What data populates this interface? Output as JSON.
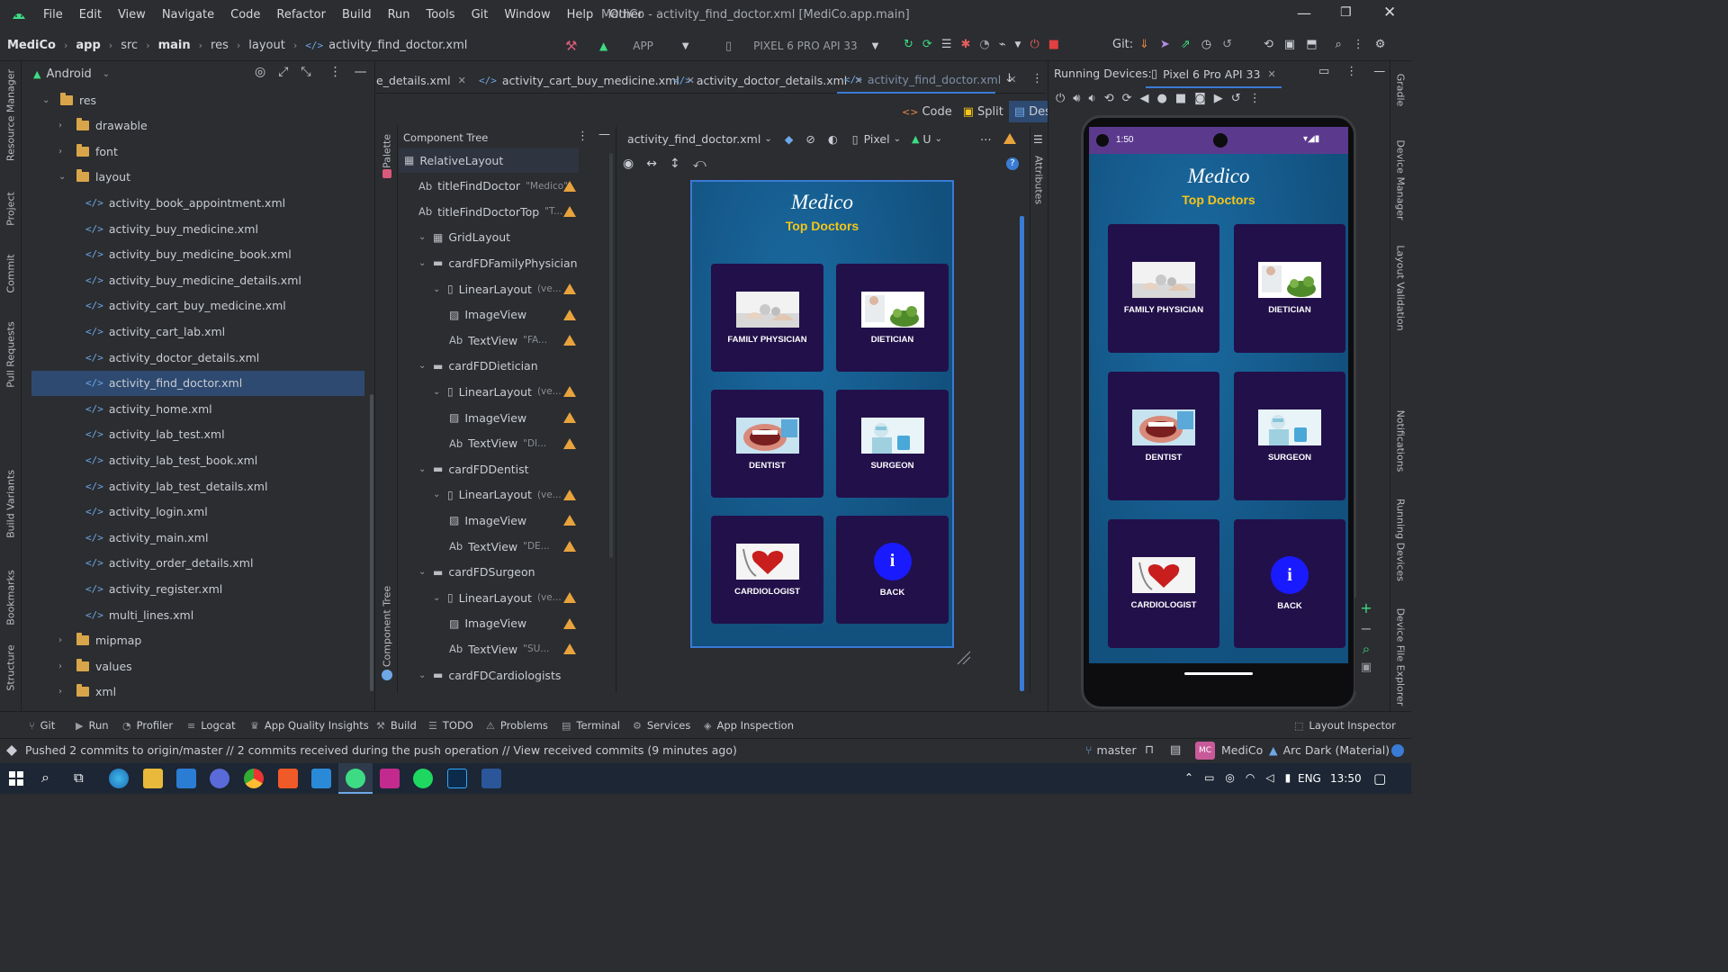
{
  "menu": {
    "items": [
      "File",
      "Edit",
      "View",
      "Navigate",
      "Code",
      "Refactor",
      "Build",
      "Run",
      "Tools",
      "Git",
      "Window",
      "Help",
      "Other"
    ],
    "window_title": "MediCo - activity_find_doctor.xml [MediCo.app.main]"
  },
  "breadcrumb": {
    "items": [
      "MediCo",
      "app",
      "src",
      "main",
      "res",
      "layout",
      "activity_find_doctor.xml"
    ]
  },
  "toolbar": {
    "run_config": "APP",
    "device": "PIXEL 6 PRO API 33",
    "git_label": "Git:"
  },
  "project": {
    "view_label": "Android",
    "tree": [
      {
        "label": "res",
        "level": 0,
        "type": "folder",
        "expanded": true
      },
      {
        "label": "drawable",
        "level": 1,
        "type": "folder",
        "expanded": false
      },
      {
        "label": "font",
        "level": 1,
        "type": "folder",
        "expanded": false
      },
      {
        "label": "layout",
        "level": 1,
        "type": "folder",
        "expanded": true
      },
      {
        "label": "activity_book_appointment.xml",
        "level": 2,
        "type": "xml"
      },
      {
        "label": "activity_buy_medicine.xml",
        "level": 2,
        "type": "xml"
      },
      {
        "label": "activity_buy_medicine_book.xml",
        "level": 2,
        "type": "xml"
      },
      {
        "label": "activity_buy_medicine_details.xml",
        "level": 2,
        "type": "xml"
      },
      {
        "label": "activity_cart_buy_medicine.xml",
        "level": 2,
        "type": "xml"
      },
      {
        "label": "activity_cart_lab.xml",
        "level": 2,
        "type": "xml"
      },
      {
        "label": "activity_doctor_details.xml",
        "level": 2,
        "type": "xml"
      },
      {
        "label": "activity_find_doctor.xml",
        "level": 2,
        "type": "xml",
        "selected": true
      },
      {
        "label": "activity_home.xml",
        "level": 2,
        "type": "xml"
      },
      {
        "label": "activity_lab_test.xml",
        "level": 2,
        "type": "xml"
      },
      {
        "label": "activity_lab_test_book.xml",
        "level": 2,
        "type": "xml"
      },
      {
        "label": "activity_lab_test_details.xml",
        "level": 2,
        "type": "xml"
      },
      {
        "label": "activity_login.xml",
        "level": 2,
        "type": "xml"
      },
      {
        "label": "activity_main.xml",
        "level": 2,
        "type": "xml"
      },
      {
        "label": "activity_order_details.xml",
        "level": 2,
        "type": "xml"
      },
      {
        "label": "activity_register.xml",
        "level": 2,
        "type": "xml"
      },
      {
        "label": "multi_lines.xml",
        "level": 2,
        "type": "xml"
      },
      {
        "label": "mipmap",
        "level": 1,
        "type": "folder",
        "expanded": false
      },
      {
        "label": "values",
        "level": 1,
        "type": "folder",
        "expanded": false
      },
      {
        "label": "xml",
        "level": 1,
        "type": "folder",
        "expanded": false
      }
    ]
  },
  "left_stripe": [
    "Resource Manager",
    "Project",
    "Commit",
    "Pull Requests",
    "Build Variants",
    "Bookmarks",
    "Structure"
  ],
  "right_stripe": [
    "Gradle",
    "Device Manager",
    "Layout Validation",
    "Notifications",
    "Running Devices",
    "Device File Explorer"
  ],
  "editor": {
    "tabs": [
      {
        "label": "e_details.xml",
        "active": false
      },
      {
        "label": "activity_cart_buy_medicine.xml",
        "active": false
      },
      {
        "label": "activity_doctor_details.xml",
        "active": false
      },
      {
        "label": "activity_find_doctor.xml",
        "active": true
      }
    ],
    "view_modes": [
      "Code",
      "Split",
      "Design"
    ],
    "file_selector": "activity_find_doctor.xml",
    "device_selector": "Pixel",
    "api_selector": "U",
    "palette_label": "Palette",
    "attributes_label": "Attributes",
    "component_tree_side_label": "Component Tree"
  },
  "component_tree": {
    "title": "Component Tree",
    "nodes": [
      {
        "type": "RelativeLayout",
        "label": "RelativeLayout",
        "level": 0,
        "hint": "",
        "warn": false,
        "selected": true
      },
      {
        "type": "Ab",
        "label": "titleFindDoctor",
        "level": 1,
        "hint": "\"Medico\"",
        "warn": true
      },
      {
        "type": "Ab",
        "label": "titleFindDoctorTop",
        "level": 1,
        "hint": "\"T...",
        "warn": true
      },
      {
        "type": "grid",
        "label": "GridLayout",
        "level": 1,
        "hint": "",
        "warn": false
      },
      {
        "type": "card",
        "label": "cardFDFamilyPhysician",
        "level": 2,
        "hint": "",
        "warn": false
      },
      {
        "type": "linear",
        "label": "LinearLayout",
        "level": 3,
        "hint": "(ve...",
        "warn": true
      },
      {
        "type": "img",
        "label": "ImageView",
        "level": 4,
        "hint": "",
        "warn": true
      },
      {
        "type": "Ab",
        "label": "TextView",
        "level": 4,
        "hint": "\"FA...",
        "warn": true
      },
      {
        "type": "card",
        "label": "cardFDDietician",
        "level": 2,
        "hint": "",
        "warn": false
      },
      {
        "type": "linear",
        "label": "LinearLayout",
        "level": 3,
        "hint": "(ve...",
        "warn": true
      },
      {
        "type": "img",
        "label": "ImageView",
        "level": 4,
        "hint": "",
        "warn": true
      },
      {
        "type": "Ab",
        "label": "TextView",
        "level": 4,
        "hint": "\"DI...",
        "warn": true
      },
      {
        "type": "card",
        "label": "cardFDDentist",
        "level": 2,
        "hint": "",
        "warn": false
      },
      {
        "type": "linear",
        "label": "LinearLayout",
        "level": 3,
        "hint": "(ve...",
        "warn": true
      },
      {
        "type": "img",
        "label": "ImageView",
        "level": 4,
        "hint": "",
        "warn": true
      },
      {
        "type": "Ab",
        "label": "TextView",
        "level": 4,
        "hint": "\"DE...",
        "warn": true
      },
      {
        "type": "card",
        "label": "cardFDSurgeon",
        "level": 2,
        "hint": "",
        "warn": false
      },
      {
        "type": "linear",
        "label": "LinearLayout",
        "level": 3,
        "hint": "(ve...",
        "warn": true
      },
      {
        "type": "img",
        "label": "ImageView",
        "level": 4,
        "hint": "",
        "warn": true
      },
      {
        "type": "Ab",
        "label": "TextView",
        "level": 4,
        "hint": "\"SU...",
        "warn": true
      },
      {
        "type": "card",
        "label": "cardFDCardiologists",
        "level": 2,
        "hint": "",
        "warn": false
      }
    ]
  },
  "app_screen": {
    "brand": "Medico",
    "subtitle": "Top Doctors",
    "cards": [
      {
        "label": "FAMILY PHYSICIAN",
        "image": "family-physician-image"
      },
      {
        "label": "DIETICIAN",
        "image": "dietician-image"
      },
      {
        "label": "DENTIST",
        "image": "dentist-image"
      },
      {
        "label": "SURGEON",
        "image": "surgeon-image"
      },
      {
        "label": "CARDIOLOGIST",
        "image": "cardiologist-image"
      },
      {
        "label": "BACK",
        "image": "info-icon"
      }
    ],
    "colors": {
      "background": "#155a8a",
      "card": "#22104a",
      "subtitle": "#f5c518",
      "back_button": "#1a1aff"
    }
  },
  "running_devices": {
    "title": "Running Devices:",
    "tab": "Pixel 6 Pro API 33",
    "phone_time": "1:50"
  },
  "tool_windows": [
    "Git",
    "Run",
    "Profiler",
    "Logcat",
    "App Quality Insights",
    "Build",
    "TODO",
    "Problems",
    "Terminal",
    "Services",
    "App Inspection",
    "Layout Inspector"
  ],
  "status_bar": {
    "message": "Pushed 2 commits to origin/master // 2 commits received during the push operation // View received commits (9 minutes ago)",
    "branch": "master",
    "project_badge": "MC",
    "project": "MediCo",
    "theme": "Arc Dark (Material)"
  },
  "taskbar": {
    "lang": "ENG",
    "time": "13:50"
  }
}
